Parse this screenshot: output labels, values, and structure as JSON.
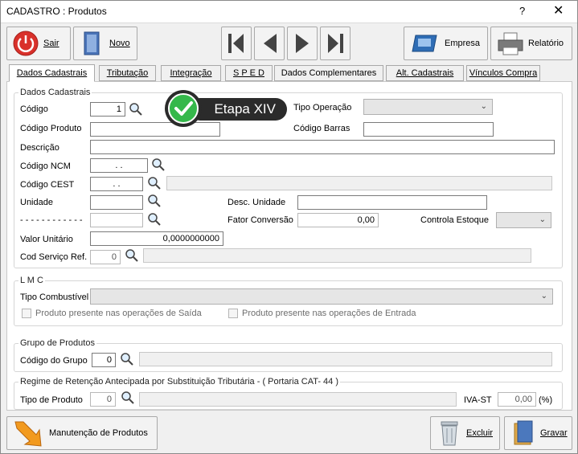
{
  "window": {
    "title": "CADASTRO : Produtos",
    "help": "?",
    "close": "✕"
  },
  "toolbar": {
    "sair": "Sair",
    "novo": "Novo",
    "empresa": "Empresa",
    "relatorio": "Relatório",
    "nav_first": "first-icon",
    "nav_prev": "prev-icon",
    "nav_next": "next-icon",
    "nav_last": "last-icon"
  },
  "tabs": [
    "Dados Cadastrais",
    "Tributação",
    "Integração",
    "S P E D",
    "Dados Complementares",
    "Alt. Cadastrais",
    "Vínculos Compra"
  ],
  "dados": {
    "group_title": "Dados Cadastrais",
    "codigo_label": "Código",
    "codigo_value": "1",
    "tipo_operacao_label": "Tipo Operação",
    "tipo_operacao_value": "",
    "codigo_produto_label": "Código Produto",
    "codigo_produto_value": "",
    "codigo_barras_label": "Código Barras",
    "codigo_barras_value": "",
    "descricao_label": "Descrição",
    "descricao_value": "",
    "ncm_label": "Código NCM",
    "ncm_value": ".  .",
    "cest_label": "Código CEST",
    "cest_value": ".  .",
    "unidade_label": "Unidade",
    "unidade_value": "",
    "desc_unidade_label": "Desc. Unidade",
    "desc_unidade_value": "",
    "dashes_label": "- - - - - - - - - - - -",
    "fator_label": "Fator Conversão",
    "fator_value": "0,00",
    "controla_label": "Controla Estoque",
    "valor_label": "Valor Unitário",
    "valor_value": "0,0000000000",
    "servico_label": "Cod Serviço Ref.",
    "servico_value": "0"
  },
  "lmc": {
    "group_title": "L M C",
    "combustivel_label": "Tipo Combustível",
    "saida_label": "Produto presente nas operações de Saída",
    "entrada_label": "Produto presente nas operações de Entrada"
  },
  "grupo": {
    "group_title": "Grupo de Produtos",
    "codigo_label": "Código do Grupo",
    "codigo_value": "0"
  },
  "regime": {
    "group_title": "Regime de Retenção Antecipada por Substituição Tributária - ( Portaria CAT- 44 )",
    "tipo_label": "Tipo de Produto",
    "tipo_value": "0",
    "iva_label": "IVA-ST",
    "iva_value": "0,00",
    "pct": "(%)"
  },
  "bottom": {
    "manutencao": "Manutenção de Produtos",
    "excluir": "Excluir",
    "gravar": "Gravar"
  },
  "callout": {
    "text": "Etapa XIV"
  }
}
